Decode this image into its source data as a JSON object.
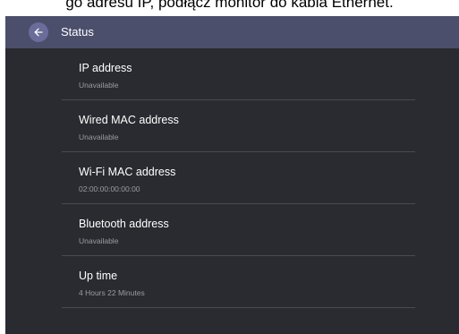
{
  "caption": "go adresu IP, podłącz monitor do kabla Ethernet.",
  "header": {
    "back_icon": "arrow-left-icon",
    "title": "Status"
  },
  "status_items": [
    {
      "label": "IP address",
      "value": "Unavailable"
    },
    {
      "label": "Wired MAC address",
      "value": "Unavailable"
    },
    {
      "label": "Wi-Fi MAC address",
      "value": "02:00:00:00:00:00"
    },
    {
      "label": "Bluetooth address",
      "value": "Unavailable"
    },
    {
      "label": "Up time",
      "value": "4 Hours 22 Minutes"
    }
  ],
  "colors": {
    "header_bg": "#4b4f6c",
    "panel_bg": "#2a2b31",
    "back_button_bg": "#6a6d99",
    "divider": "#4a4b52"
  }
}
